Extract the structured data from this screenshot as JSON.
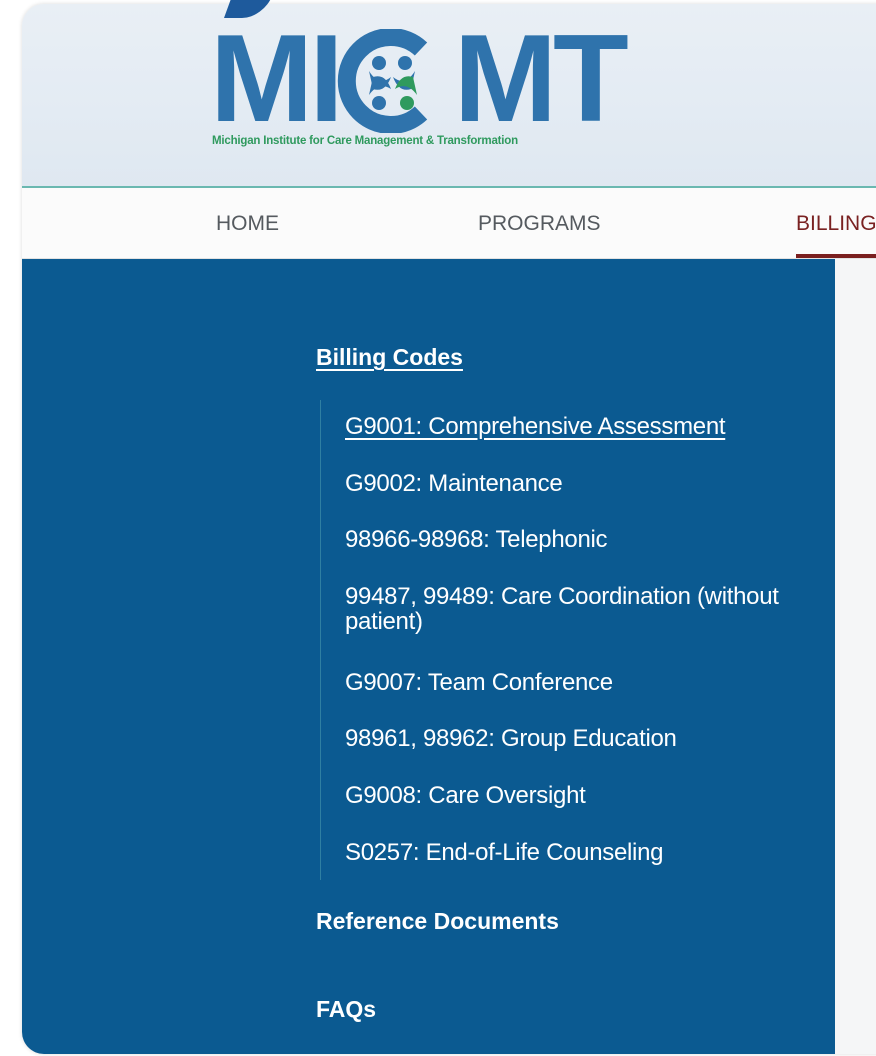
{
  "brand": {
    "wordmark_left": "MI",
    "wordmark_right": "MT",
    "tagline": "Michigan Institute for Care Management & Transformation",
    "primary_color": "#2f73ac",
    "accent_green": "#2f9a5e",
    "emblem_icon": "people-circle-logo-icon"
  },
  "nav": {
    "items": [
      {
        "label": "HOME"
      },
      {
        "label": "PROGRAMS"
      },
      {
        "label": "BILLING"
      }
    ],
    "active_index": 2,
    "active_color": "#7a1f1f"
  },
  "sidebar": {
    "background": "#0b5a91",
    "billing_codes": {
      "label": "Billing Codes",
      "items": [
        {
          "label": "G9001: Comprehensive Assessment",
          "active": true
        },
        {
          "label": "G9002: Maintenance",
          "active": false
        },
        {
          "label": "98966-98968: Telephonic",
          "active": false
        },
        {
          "label": "99487, 99489: Care Coordination (without patient)",
          "active": false
        },
        {
          "label": "G9007: Team Conference",
          "active": false
        },
        {
          "label": "98961, 98962: Group Education",
          "active": false
        },
        {
          "label": "G9008: Care Oversight",
          "active": false
        },
        {
          "label": "S0257: End-of-Life Counseling",
          "active": false
        }
      ]
    },
    "reference_documents": {
      "label": "Reference Documents"
    },
    "faqs": {
      "label": "FAQs"
    }
  }
}
